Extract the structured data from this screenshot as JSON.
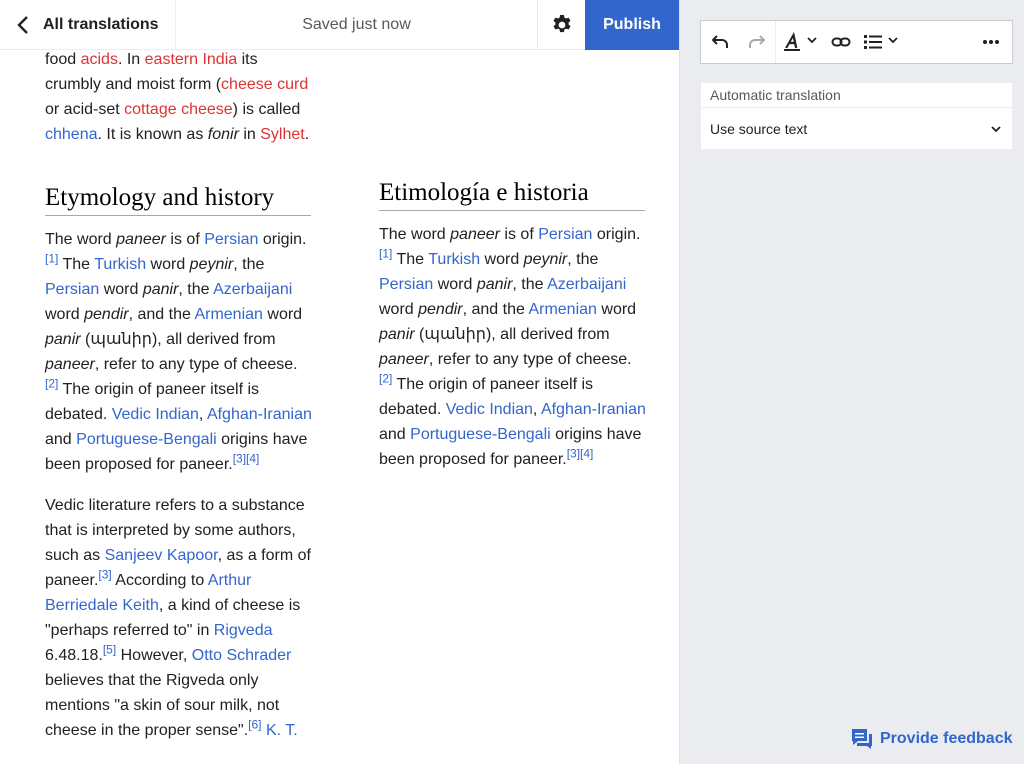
{
  "header": {
    "back_label": "All translations",
    "saved_status": "Saved just now",
    "publish_label": "Publish"
  },
  "source": {
    "lead": {
      "t1": "food ",
      "acids": "acids",
      "t2": ". In ",
      "eastern_india": "eastern India",
      "t3": " its crumbly and moist form (",
      "cheese_curd": "cheese curd",
      "t4": " or acid-set ",
      "cottage_cheese": "cottage cheese",
      "t5": ") is called ",
      "chhena": "chhena",
      "t6": ". It is known as ",
      "fonir": "fonir",
      "t7": " in ",
      "sylhet": "Sylhet",
      "t8": "."
    },
    "heading": "Etymology and history",
    "para1": {
      "t1": "The word ",
      "paneer": "paneer",
      "t2": " is of ",
      "persian": "Persian",
      "t3": " origin.",
      "ref1": "[1]",
      "t4": " The ",
      "turkish": "Turkish",
      "t5": " word ",
      "peynir": "peynir",
      "t6": ", the ",
      "persian2": "Persian",
      "t7": " word ",
      "panir": "panir",
      "t8": ", the ",
      "azerbaijani": "Azerbaijani",
      "t9": " word ",
      "pendir": "pendir",
      "t10": ", and the ",
      "armenian": "Armenian",
      "t11": " word ",
      "panir2": "panir",
      "t12": " (պանիր), all derived from ",
      "paneer2": "paneer",
      "t13": ", refer to any type of cheese.",
      "ref2": "[2]",
      "t14": " The origin of paneer itself is debated. ",
      "vedic_indian": "Vedic Indian",
      "t15": ", ",
      "afghan_iranian": "Afghan-Iranian",
      "t16": " and ",
      "portuguese_bengali": "Portuguese-Bengali",
      "t17": " origins have been proposed for paneer.",
      "ref3": "[3]",
      "ref4": "[4]"
    },
    "para2": {
      "t1": "Vedic literature refers to a substance that is interpreted by some authors, such as ",
      "sanjeev_kapoor": "Sanjeev Kapoor",
      "t2": ", as a form of paneer.",
      "ref3": "[3]",
      "t3": " According to ",
      "arthur_keith": "Arthur Berriedale Keith",
      "t4": ", a kind of cheese is \"perhaps referred to\" in ",
      "rigveda": "Rigveda",
      "t5": " 6.48.18.",
      "ref5": "[5]",
      "t6": " However, ",
      "otto_schrader": "Otto Schrader",
      "t7": " believes that the Rigveda only mentions \"a skin of sour milk, not cheese in the proper sense\".",
      "ref6": "[6]",
      "t8": " ",
      "kt": "K. T."
    }
  },
  "target": {
    "heading": "Etimología e historia",
    "para1": {
      "t1": "The word ",
      "paneer": "paneer",
      "t2": " is of ",
      "persian": "Persian",
      "t3": " origin.",
      "ref1": "[1]",
      "t4": " The ",
      "turkish": "Turkish",
      "t5": " word ",
      "peynir": "peynir",
      "t6": ", the ",
      "persian2": "Persian",
      "t7": " word ",
      "panir": "panir",
      "t8": ", the ",
      "azerbaijani": "Azerbaijani",
      "t9": " word ",
      "pendir": "pendir",
      "t10": ", and the ",
      "armenian": "Armenian",
      "t11": " word ",
      "panir2": "panir",
      "t12": " (պանիր), all derived from ",
      "paneer2": "paneer",
      "t13": ", refer to any type of cheese.",
      "ref2": "[2]",
      "t14": " The origin of paneer itself is debated. ",
      "vedic_indian": "Vedic Indian",
      "t15": ", ",
      "afghan_iranian": "Afghan-Iranian",
      "t16": " and ",
      "portuguese_bengali": "Portuguese-Bengali",
      "t17": " origins have been proposed for paneer.",
      "ref3": "[3]",
      "ref4": "[4]"
    }
  },
  "sidebar": {
    "mt_title": "Automatic translation",
    "mt_option": "Use source text",
    "feedback_label": "Provide feedback"
  },
  "colors": {
    "accent": "#3366cc",
    "redlink": "#d33",
    "panel_bg": "#eaecf0"
  }
}
